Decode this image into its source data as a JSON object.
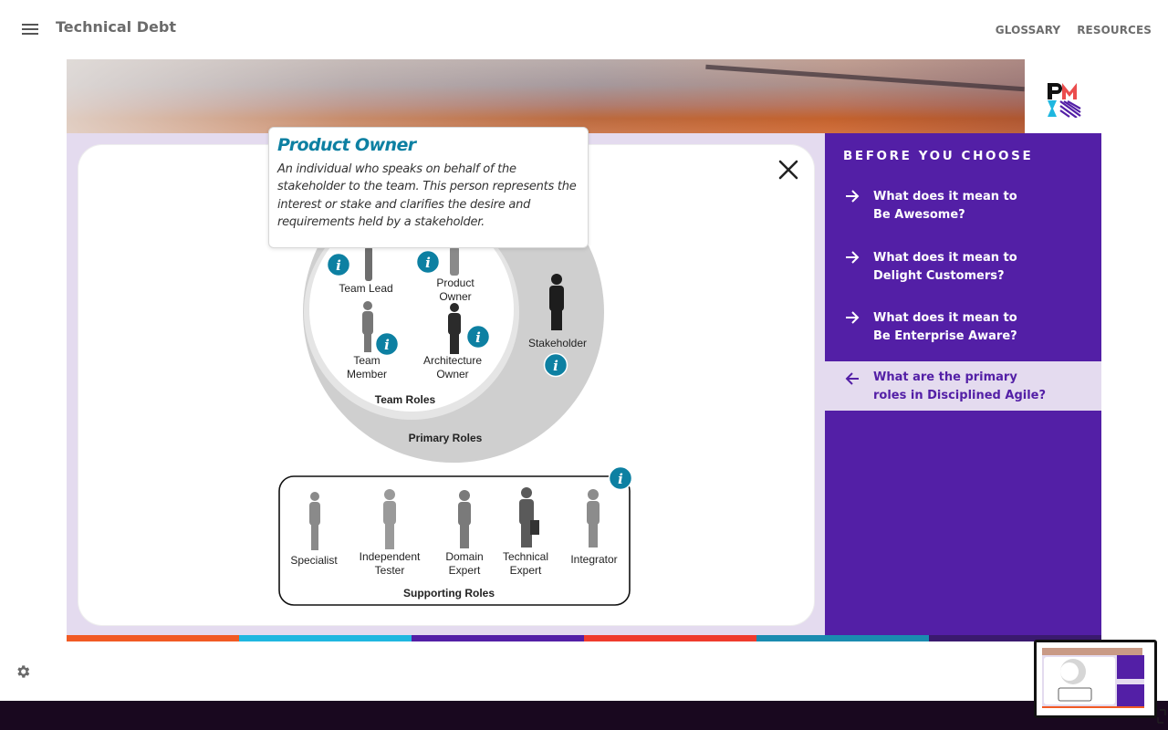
{
  "header": {
    "title": "Technical Debt",
    "nav": [
      "GLOSSARY",
      "RESOURCES"
    ]
  },
  "tooltip": {
    "title": "Product Owner",
    "body": "An individual who speaks on behalf of the stakeholder to the team. This person represents the interest or stake and clarifies the desire and requirements held by a stakeholder."
  },
  "diagram": {
    "primary_roles_label": "Primary Roles",
    "team_roles_label": "Team Roles",
    "team_lead": "Team Lead",
    "product_owner": [
      "Product",
      "Owner"
    ],
    "team_member": [
      "Team",
      "Member"
    ],
    "architecture_owner": [
      "Architecture",
      "Owner"
    ],
    "stakeholder": "Stakeholder",
    "supporting_roles_label": "Supporting Roles",
    "supporting": {
      "specialist": "Specialist",
      "independent_tester": [
        "Independent",
        "Tester"
      ],
      "domain_expert": [
        "Domain",
        "Expert"
      ],
      "technical_expert": [
        "Technical",
        "Expert"
      ],
      "integrator": "Integrator"
    }
  },
  "sidebar": {
    "heading": "BEFORE YOU CHOOSE",
    "items": [
      {
        "line1": "What does it mean to",
        "line2": "Be Awesome?"
      },
      {
        "line1": "What does it mean to",
        "line2": "Delight Customers?"
      },
      {
        "line1": "What does it mean to",
        "line2": "Be Enterprise Aware?"
      },
      {
        "line1": "What are the primary",
        "line2": "roles in Disciplined Agile?"
      }
    ]
  },
  "colors": {
    "purple": "#531fa6",
    "light_purple": "#e4dbef",
    "teal_info": "#0d80a2",
    "footer": "#19081f",
    "stripes": [
      "#f15a24",
      "#1fb7e0",
      "#531fa6",
      "#ef3b2c",
      "#1a8bb0",
      "#3a1a6e"
    ]
  },
  "icons": [
    "menu-icon",
    "close-icon",
    "info-icon",
    "arrow-right-icon",
    "arrow-left-icon",
    "gear-icon",
    "pmi-logo"
  ]
}
